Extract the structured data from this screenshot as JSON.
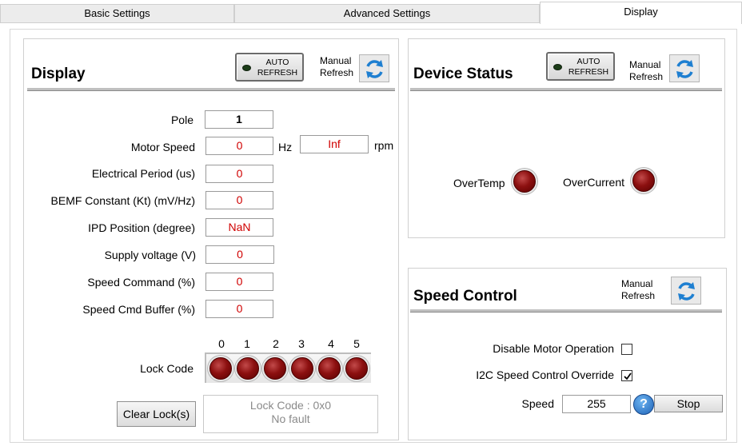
{
  "tabs": [
    "Basic Settings",
    "Advanced Settings",
    "Display"
  ],
  "display_panel": {
    "title": "Display",
    "auto_refresh": "AUTO\nREFRESH",
    "manual_refresh": "Manual\nRefresh",
    "fields": [
      {
        "label": "Pole",
        "value": "1"
      },
      {
        "label": "Motor Speed",
        "value": "0",
        "unit": "Hz",
        "value2": "Inf",
        "unit2": "rpm"
      },
      {
        "label": "Electrical Period (us)",
        "value": "0"
      },
      {
        "label": "BEMF Constant (Kt) (mV/Hz)",
        "value": "0"
      },
      {
        "label": "IPD Position (degree)",
        "value": "NaN"
      },
      {
        "label": "Supply voltage (V)",
        "value": "0"
      },
      {
        "label": "Speed Command (%)",
        "value": "0"
      },
      {
        "label": "Speed Cmd Buffer (%)",
        "value": "0"
      }
    ],
    "lock_code_label": "Lock Code",
    "lock_bits": [
      "0",
      "1",
      "2",
      "3",
      "4",
      "5"
    ],
    "clear_lock_button": "Clear Lock(s)",
    "lock_status_line1": "Lock Code : 0x0",
    "lock_status_line2": "No fault"
  },
  "device_status": {
    "title": "Device Status",
    "auto_refresh": "AUTO\nREFRESH",
    "manual_refresh": "Manual\nRefresh",
    "overtemp": "OverTemp",
    "overcurrent": "OverCurrent"
  },
  "speed_control": {
    "title": "Speed Control",
    "manual_refresh": "Manual\nRefresh",
    "disable_motor_label": "Disable Motor Operation",
    "disable_motor_checked": false,
    "i2c_override_label": "I2C Speed Control Override",
    "i2c_override_checked": true,
    "speed_label": "Speed",
    "speed_value": "255",
    "help_icon": "?",
    "stop_button": "Stop"
  }
}
